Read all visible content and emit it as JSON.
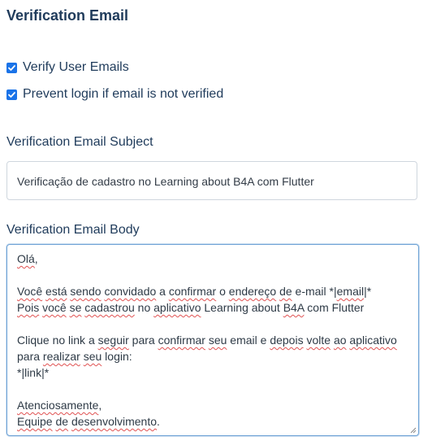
{
  "section": {
    "title": "Verification Email"
  },
  "options": {
    "verify_user_emails": {
      "label": "Verify User Emails",
      "checked": true
    },
    "prevent_login": {
      "label": "Prevent login if email is not verified",
      "checked": true
    }
  },
  "subject": {
    "label": "Verification Email Subject",
    "value": "Verificação de cadastro no Learning about B4A com Flutter"
  },
  "body": {
    "label": "Verification Email Body",
    "lines": [
      [
        {
          "t": "Olá",
          "s": true
        },
        {
          "t": ","
        }
      ],
      [],
      [
        {
          "t": "Você",
          "s": true
        },
        {
          "t": " "
        },
        {
          "t": "está",
          "s": true
        },
        {
          "t": " "
        },
        {
          "t": "sendo",
          "s": true
        },
        {
          "t": " "
        },
        {
          "t": "convidado",
          "s": true
        },
        {
          "t": " a "
        },
        {
          "t": "confirmar",
          "s": true
        },
        {
          "t": " o "
        },
        {
          "t": "endereço",
          "s": true
        },
        {
          "t": " "
        },
        {
          "t": "de",
          "s": true
        },
        {
          "t": " e-mail *|"
        },
        {
          "t": "email",
          "s": true
        },
        {
          "t": "|*"
        }
      ],
      [
        {
          "t": "Pois",
          "s": true
        },
        {
          "t": " "
        },
        {
          "t": "você",
          "s": true
        },
        {
          "t": " "
        },
        {
          "t": "se",
          "s": true
        },
        {
          "t": " "
        },
        {
          "t": "cadastrou",
          "s": true
        },
        {
          "t": " no "
        },
        {
          "t": "aplicativo",
          "s": true
        },
        {
          "t": " Learning about "
        },
        {
          "t": "B4A",
          "s": true
        },
        {
          "t": " com Flutter"
        }
      ],
      [],
      [
        {
          "t": "Clique no link a "
        },
        {
          "t": "seguir",
          "s": true
        },
        {
          "t": " para "
        },
        {
          "t": "confirmar",
          "s": true
        },
        {
          "t": " "
        },
        {
          "t": "seu",
          "s": true
        },
        {
          "t": " email e "
        },
        {
          "t": "depois",
          "s": true
        },
        {
          "t": " "
        },
        {
          "t": "volte",
          "s": true
        },
        {
          "t": " "
        },
        {
          "t": "ao",
          "s": true
        },
        {
          "t": " "
        },
        {
          "t": "aplicativo",
          "s": true
        }
      ],
      [
        {
          "t": "para "
        },
        {
          "t": "realizar",
          "s": true
        },
        {
          "t": " "
        },
        {
          "t": "seu",
          "s": true
        },
        {
          "t": " login:"
        }
      ],
      [
        {
          "t": "*|link|*"
        }
      ],
      [],
      [
        {
          "t": "Atenciosamente",
          "s": true
        },
        {
          "t": ","
        }
      ],
      [
        {
          "t": "Equipe",
          "s": true
        },
        {
          "t": " "
        },
        {
          "t": "de",
          "s": true
        },
        {
          "t": " "
        },
        {
          "t": "desenvolvimento",
          "s": true
        },
        {
          "t": "."
        }
      ]
    ]
  },
  "colors": {
    "text": "#1f3b5b",
    "checkbox": "#1a73e8",
    "focus_border": "#6fa3d6",
    "spellcheck": "#e05252"
  }
}
